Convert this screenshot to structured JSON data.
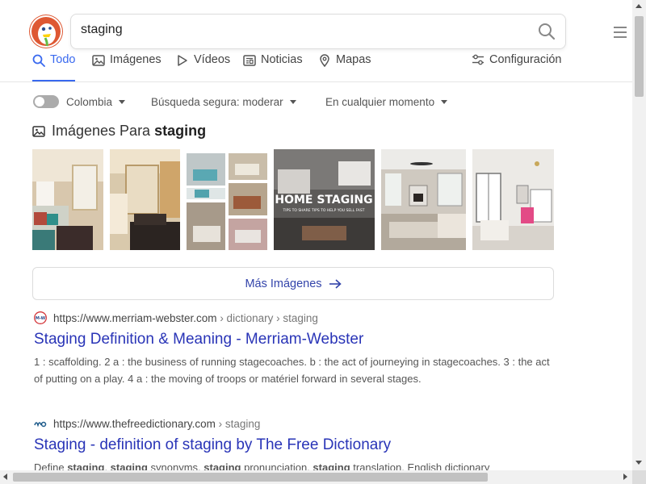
{
  "search": {
    "query": "staging"
  },
  "tabs": [
    {
      "label": "Todo",
      "icon": "search-icon",
      "active": true
    },
    {
      "label": "Imágenes",
      "icon": "image-icon"
    },
    {
      "label": "Vídeos",
      "icon": "play-icon"
    },
    {
      "label": "Noticias",
      "icon": "newspaper-icon"
    },
    {
      "label": "Mapas",
      "icon": "map-pin-icon"
    }
  ],
  "settings": {
    "label": "Configuración",
    "icon": "sliders-icon"
  },
  "filters": {
    "region": "Colombia",
    "safe_search": "Búsqueda segura: moderar",
    "time": "En cualquier momento"
  },
  "images_section": {
    "heading_prefix": "Imágenes Para",
    "heading_query": "staging",
    "home_staging_text": "HOME STAGING",
    "home_staging_subtext": "TIPS TO SHARE TIPS TO HELP YOU SELL FAST",
    "more_label": "Más Imágenes"
  },
  "results": [
    {
      "url": "https://www.merriam-webster.com",
      "breadcrumb": "› dictionary › staging",
      "title": "Staging Definition & Meaning - Merriam-Webster",
      "snippet": "1 : scaffolding. 2 a : the business of running stagecoaches. b : the act of journeying in stagecoaches. 3 : the act of putting on a play. 4 a : the moving of troops or matériel forward in several stages.",
      "favicon_text": "M-W"
    },
    {
      "url": "https://www.thefreedictionary.com",
      "breadcrumb": "› staging",
      "title": "Staging - definition of staging by The Free Dictionary",
      "snippet_parts": [
        "Define ",
        "staging",
        ", ",
        "staging",
        " synonyms, ",
        "staging",
        " pronunciation, ",
        "staging",
        " translation, English dictionary"
      ]
    }
  ],
  "colors": {
    "accent": "#3969ef",
    "link": "#2934b7",
    "logo": "#de5833"
  }
}
